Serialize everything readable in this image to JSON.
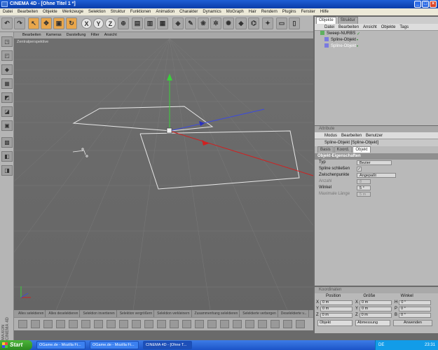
{
  "window": {
    "title": "CINEMA 4D - [Ohne Titel 1 *]"
  },
  "menubar": [
    "Datei",
    "Bearbeiten",
    "Objekte",
    "Werkzeuge",
    "Selektion",
    "Struktur",
    "Funktionen",
    "Animation",
    "Charakter",
    "Dynamics",
    "MoGraph",
    "Hair",
    "Rendern",
    "Plugins",
    "Fenster",
    "Hilfe"
  ],
  "toolbar": {
    "axis_x": "X",
    "axis_y": "Y",
    "axis_z": "Z"
  },
  "viewport": {
    "menu": [
      "Bearbeiten",
      "Kameras",
      "Darstellung",
      "Filter",
      "Ansicht"
    ],
    "label": "Zentralperspektive"
  },
  "bottombar": [
    "Alles selektieren",
    "Alles deselektieren",
    "Selektion invertieren",
    "Selektion vergrößern",
    "Selektion verkleinern",
    "Zusammenhang selektieren",
    "Selektierte verbergen",
    "Deselektierte v..."
  ],
  "maxon": "MAXON CINEMA 4D",
  "object_manager": {
    "tabs": [
      "Objekte",
      "Struktur"
    ],
    "menu": [
      "Datei",
      "Bearbeiten",
      "Ansicht",
      "Objekte",
      "Tags"
    ],
    "items": [
      {
        "name": "Sweep-NURBS",
        "selected": false
      },
      {
        "name": "Spline-Objekt",
        "selected": false
      },
      {
        "name": "Spline-Objekt",
        "selected": true
      }
    ]
  },
  "attributes": {
    "header": "Attribute",
    "menu": [
      "Modus",
      "Bearbeiten",
      "Benutzer"
    ],
    "title": "Spline-Objekt [Spline-Objekt]",
    "tabs": [
      "Basis",
      "Koord.",
      "Objekt"
    ],
    "section": "Objekt-Eigenschaften",
    "props": {
      "typ": {
        "label": "Typ",
        "value": "Bezier"
      },
      "schliessen": {
        "label": "Spline schließen",
        "value": "✓"
      },
      "zwischenpunkte": {
        "label": "Zwischenpunkte",
        "value": "Angepaßt"
      },
      "anzahl": {
        "label": "Anzahl",
        "value": "8"
      },
      "winkel": {
        "label": "Winkel",
        "value": "5 °"
      },
      "laenge": {
        "label": "Maximale Länge",
        "value": "5 m"
      }
    }
  },
  "coordinates": {
    "header": "Koordinaten",
    "cols": [
      "Position",
      "Größe",
      "Winkel"
    ],
    "rows": [
      {
        "axis": "X",
        "pos": "0 m",
        "sz_axis": "X",
        "size": "0 m",
        "rot_axis": "H",
        "rot": "0 °"
      },
      {
        "axis": "Y",
        "pos": "0 m",
        "sz_axis": "Y",
        "size": "0 m",
        "rot_axis": "P",
        "rot": "0 °"
      },
      {
        "axis": "Z",
        "pos": "0 m",
        "sz_axis": "Z",
        "size": "0 m",
        "rot_axis": "B",
        "rot": "0 °"
      }
    ],
    "mode": "Objekt",
    "size_mode": "Abmessung",
    "apply": "Anwenden"
  },
  "taskbar": {
    "start": "Start",
    "items": [
      "OGame.de - Mozilla Fi...",
      "OGame.de - Mozilla Fi...",
      "CINEMA 4D - [Ohne T..."
    ],
    "lang": "DE",
    "clock": "23:31"
  }
}
